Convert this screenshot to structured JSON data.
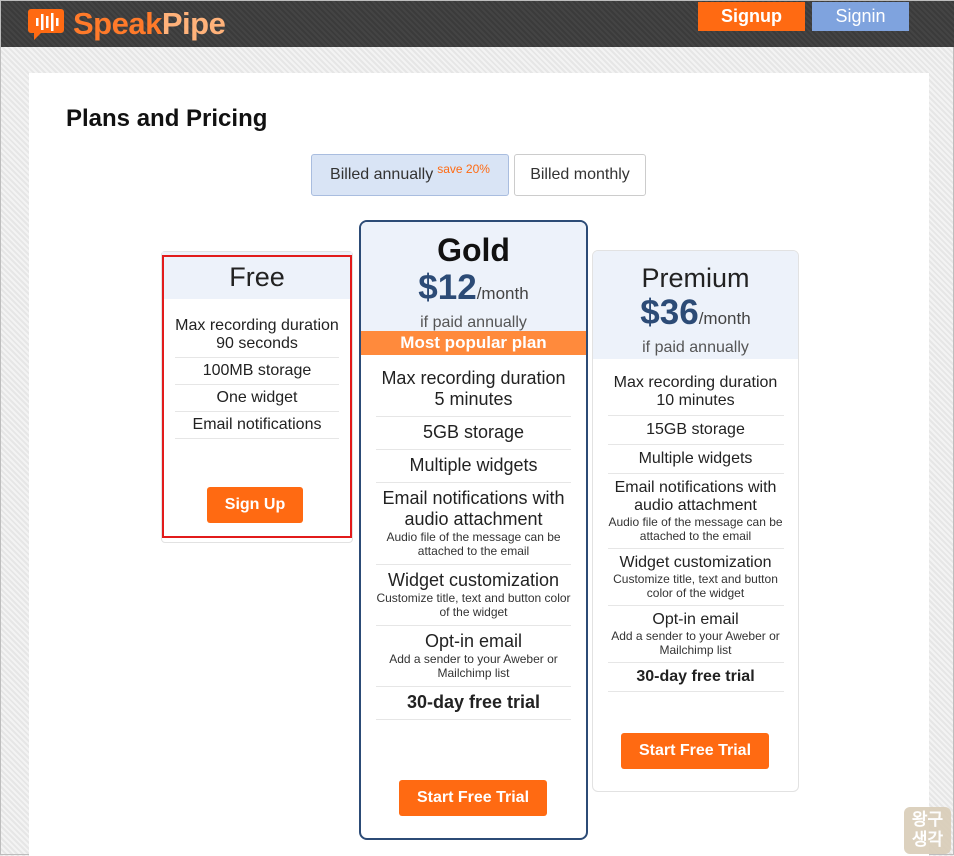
{
  "header": {
    "logo": {
      "speak": "Speak",
      "pipe": "Pipe"
    },
    "signup_label": "Signup",
    "signin_label": "Signin"
  },
  "page": {
    "title": "Plans and Pricing",
    "billing": {
      "annual_label": "Billed annually",
      "save_badge": "save 20%",
      "monthly_label": "Billed monthly"
    }
  },
  "plans": {
    "free": {
      "name": "Free",
      "features": [
        "Max recording duration 90 seconds",
        "100MB storage",
        "One widget",
        "Email notifications"
      ],
      "cta": "Sign Up"
    },
    "gold": {
      "name": "Gold",
      "price": "$12",
      "per": "/month",
      "billing_note": "if paid annually",
      "badge": "Most popular plan",
      "features": [
        {
          "title": "Max recording duration 5 minutes",
          "desc": ""
        },
        {
          "title": "5GB storage",
          "desc": ""
        },
        {
          "title": "Multiple widgets",
          "desc": ""
        },
        {
          "title": "Email notifications with audio attachment",
          "desc": "Audio file of the message can be attached to the email"
        },
        {
          "title": "Widget customization",
          "desc": "Customize title, text and button color of the widget"
        },
        {
          "title": "Opt-in email",
          "desc": "Add a sender to your Aweber or Mailchimp list"
        },
        {
          "title": "30-day free trial",
          "desc": ""
        }
      ],
      "cta": "Start Free Trial"
    },
    "premium": {
      "name": "Premium",
      "price": "$36",
      "per": "/month",
      "billing_note": "if paid annually",
      "features": [
        {
          "title": "Max recording duration 10 minutes",
          "desc": ""
        },
        {
          "title": "15GB storage",
          "desc": ""
        },
        {
          "title": "Multiple widgets",
          "desc": ""
        },
        {
          "title": "Email notifications with audio attachment",
          "desc": "Audio file of the message can be attached to the email"
        },
        {
          "title": "Widget customization",
          "desc": "Customize title, text and button color of the widget"
        },
        {
          "title": "Opt-in email",
          "desc": "Add a sender to your Aweber or Mailchimp list"
        },
        {
          "title": "30-day free trial",
          "desc": ""
        }
      ],
      "cta": "Start Free Trial"
    }
  },
  "watermark": {
    "line1": "왕구",
    "line2": "생각"
  },
  "colors": {
    "accent": "#ff6a12",
    "brand_blue": "#2c4b76",
    "signin": "#7fa3de",
    "highlight_border": "#e21b1b"
  }
}
